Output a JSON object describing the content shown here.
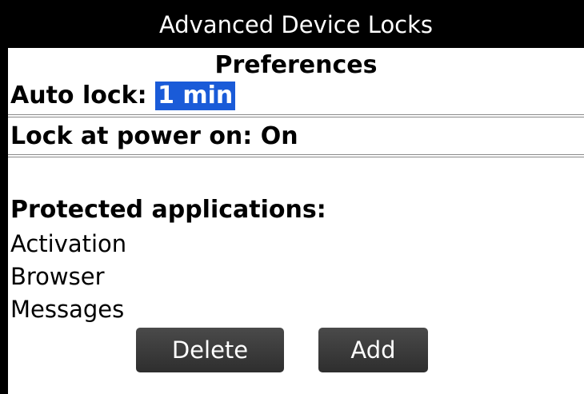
{
  "window": {
    "title": "Advanced Device Locks"
  },
  "preferences": {
    "heading": "Preferences",
    "auto_lock": {
      "label": "Auto lock:",
      "value": "1 min"
    },
    "lock_at_power_on": {
      "label": "Lock at power on:",
      "value": "On"
    }
  },
  "protected_apps": {
    "heading": "Protected applications:",
    "items": [
      "Activation",
      "Browser",
      "Messages"
    ]
  },
  "buttons": {
    "delete_label": "Delete",
    "add_label": "Add"
  },
  "colors": {
    "title_bar_bg": "#000000",
    "selection_bg": "#1a5bd8",
    "button_bg": "#3a3a3a"
  }
}
